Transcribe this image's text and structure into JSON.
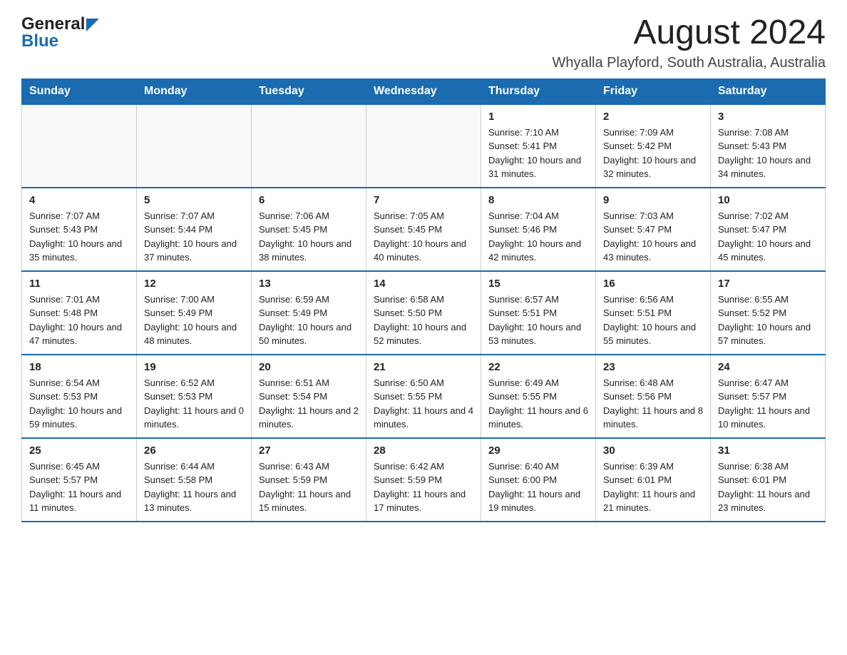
{
  "header": {
    "logo_general": "General",
    "logo_blue": "Blue",
    "month_title": "August 2024",
    "location": "Whyalla Playford, South Australia, Australia"
  },
  "days_of_week": [
    "Sunday",
    "Monday",
    "Tuesday",
    "Wednesday",
    "Thursday",
    "Friday",
    "Saturday"
  ],
  "weeks": [
    [
      {
        "day": "",
        "info": ""
      },
      {
        "day": "",
        "info": ""
      },
      {
        "day": "",
        "info": ""
      },
      {
        "day": "",
        "info": ""
      },
      {
        "day": "1",
        "info": "Sunrise: 7:10 AM\nSunset: 5:41 PM\nDaylight: 10 hours and 31 minutes."
      },
      {
        "day": "2",
        "info": "Sunrise: 7:09 AM\nSunset: 5:42 PM\nDaylight: 10 hours and 32 minutes."
      },
      {
        "day": "3",
        "info": "Sunrise: 7:08 AM\nSunset: 5:43 PM\nDaylight: 10 hours and 34 minutes."
      }
    ],
    [
      {
        "day": "4",
        "info": "Sunrise: 7:07 AM\nSunset: 5:43 PM\nDaylight: 10 hours and 35 minutes."
      },
      {
        "day": "5",
        "info": "Sunrise: 7:07 AM\nSunset: 5:44 PM\nDaylight: 10 hours and 37 minutes."
      },
      {
        "day": "6",
        "info": "Sunrise: 7:06 AM\nSunset: 5:45 PM\nDaylight: 10 hours and 38 minutes."
      },
      {
        "day": "7",
        "info": "Sunrise: 7:05 AM\nSunset: 5:45 PM\nDaylight: 10 hours and 40 minutes."
      },
      {
        "day": "8",
        "info": "Sunrise: 7:04 AM\nSunset: 5:46 PM\nDaylight: 10 hours and 42 minutes."
      },
      {
        "day": "9",
        "info": "Sunrise: 7:03 AM\nSunset: 5:47 PM\nDaylight: 10 hours and 43 minutes."
      },
      {
        "day": "10",
        "info": "Sunrise: 7:02 AM\nSunset: 5:47 PM\nDaylight: 10 hours and 45 minutes."
      }
    ],
    [
      {
        "day": "11",
        "info": "Sunrise: 7:01 AM\nSunset: 5:48 PM\nDaylight: 10 hours and 47 minutes."
      },
      {
        "day": "12",
        "info": "Sunrise: 7:00 AM\nSunset: 5:49 PM\nDaylight: 10 hours and 48 minutes."
      },
      {
        "day": "13",
        "info": "Sunrise: 6:59 AM\nSunset: 5:49 PM\nDaylight: 10 hours and 50 minutes."
      },
      {
        "day": "14",
        "info": "Sunrise: 6:58 AM\nSunset: 5:50 PM\nDaylight: 10 hours and 52 minutes."
      },
      {
        "day": "15",
        "info": "Sunrise: 6:57 AM\nSunset: 5:51 PM\nDaylight: 10 hours and 53 minutes."
      },
      {
        "day": "16",
        "info": "Sunrise: 6:56 AM\nSunset: 5:51 PM\nDaylight: 10 hours and 55 minutes."
      },
      {
        "day": "17",
        "info": "Sunrise: 6:55 AM\nSunset: 5:52 PM\nDaylight: 10 hours and 57 minutes."
      }
    ],
    [
      {
        "day": "18",
        "info": "Sunrise: 6:54 AM\nSunset: 5:53 PM\nDaylight: 10 hours and 59 minutes."
      },
      {
        "day": "19",
        "info": "Sunrise: 6:52 AM\nSunset: 5:53 PM\nDaylight: 11 hours and 0 minutes."
      },
      {
        "day": "20",
        "info": "Sunrise: 6:51 AM\nSunset: 5:54 PM\nDaylight: 11 hours and 2 minutes."
      },
      {
        "day": "21",
        "info": "Sunrise: 6:50 AM\nSunset: 5:55 PM\nDaylight: 11 hours and 4 minutes."
      },
      {
        "day": "22",
        "info": "Sunrise: 6:49 AM\nSunset: 5:55 PM\nDaylight: 11 hours and 6 minutes."
      },
      {
        "day": "23",
        "info": "Sunrise: 6:48 AM\nSunset: 5:56 PM\nDaylight: 11 hours and 8 minutes."
      },
      {
        "day": "24",
        "info": "Sunrise: 6:47 AM\nSunset: 5:57 PM\nDaylight: 11 hours and 10 minutes."
      }
    ],
    [
      {
        "day": "25",
        "info": "Sunrise: 6:45 AM\nSunset: 5:57 PM\nDaylight: 11 hours and 11 minutes."
      },
      {
        "day": "26",
        "info": "Sunrise: 6:44 AM\nSunset: 5:58 PM\nDaylight: 11 hours and 13 minutes."
      },
      {
        "day": "27",
        "info": "Sunrise: 6:43 AM\nSunset: 5:59 PM\nDaylight: 11 hours and 15 minutes."
      },
      {
        "day": "28",
        "info": "Sunrise: 6:42 AM\nSunset: 5:59 PM\nDaylight: 11 hours and 17 minutes."
      },
      {
        "day": "29",
        "info": "Sunrise: 6:40 AM\nSunset: 6:00 PM\nDaylight: 11 hours and 19 minutes."
      },
      {
        "day": "30",
        "info": "Sunrise: 6:39 AM\nSunset: 6:01 PM\nDaylight: 11 hours and 21 minutes."
      },
      {
        "day": "31",
        "info": "Sunrise: 6:38 AM\nSunset: 6:01 PM\nDaylight: 11 hours and 23 minutes."
      }
    ]
  ]
}
